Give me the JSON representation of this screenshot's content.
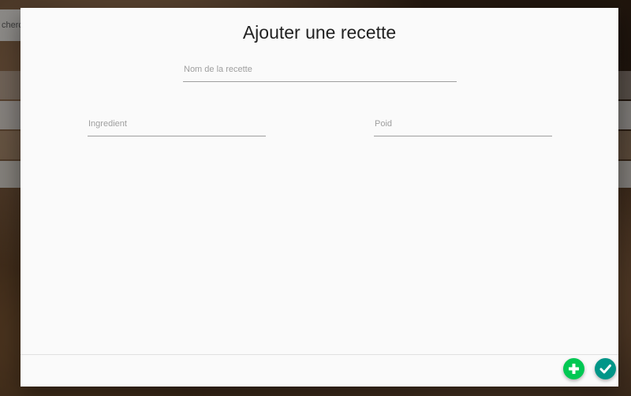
{
  "background": {
    "search_partial_text": "cherc"
  },
  "modal": {
    "title": "Ajouter une recette",
    "recipe_name": {
      "placeholder": "Nom de la recette",
      "value": ""
    },
    "ingredient": {
      "placeholder": "Ingredient",
      "value": ""
    },
    "weight": {
      "placeholder": "Poid",
      "value": ""
    },
    "actions": {
      "add_icon": "plus-icon",
      "confirm_icon": "check-icon",
      "add_color": "#00c853",
      "confirm_color": "#009688"
    }
  }
}
